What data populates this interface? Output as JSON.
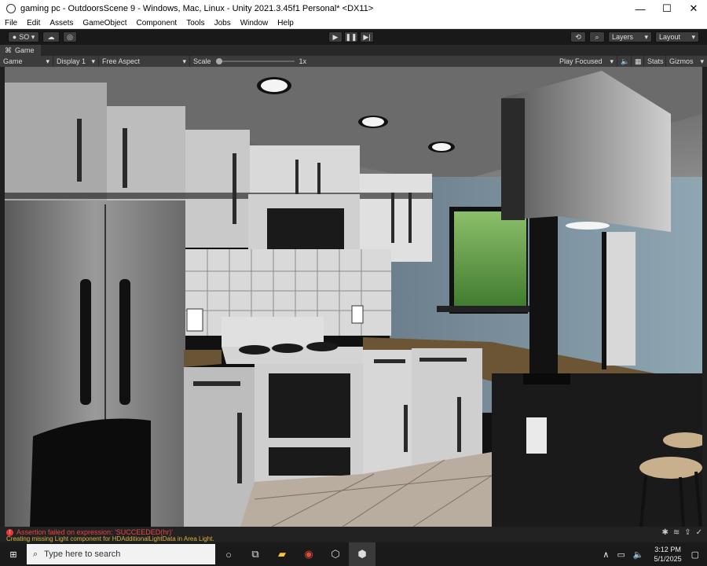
{
  "window": {
    "title": "gaming pc - OutdoorsScene 9 - Windows, Mac, Linux - Unity 2021.3.45f1 Personal* <DX11>",
    "controls": {
      "minimize": "—",
      "maximize": "☐",
      "close": "✕"
    }
  },
  "menu": [
    "File",
    "Edit",
    "Assets",
    "GameObject",
    "Component",
    "Tools",
    "Jobs",
    "Window",
    "Help"
  ],
  "toolbar": {
    "account_label": "SO ▾",
    "layers_label": "Layers",
    "layout_label": "Layout"
  },
  "game_tab": {
    "label": "Game"
  },
  "game_bar": {
    "mode": "Game",
    "display": "Display 1",
    "aspect": "Free Aspect",
    "scale_label": "Scale",
    "scale_value": "1x",
    "play_mode": "Play Focused",
    "stats": "Stats",
    "gizmos": "Gizmos"
  },
  "console": {
    "error": "Assertion failed on expression: 'SUCCEEDED(hr)'",
    "warning": "Creating missing Light component for HDAdditionalLightData in Area Light."
  },
  "taskbar": {
    "search_placeholder": "Type here to search",
    "time": "3:12 PM",
    "date": "5/1/2025"
  }
}
